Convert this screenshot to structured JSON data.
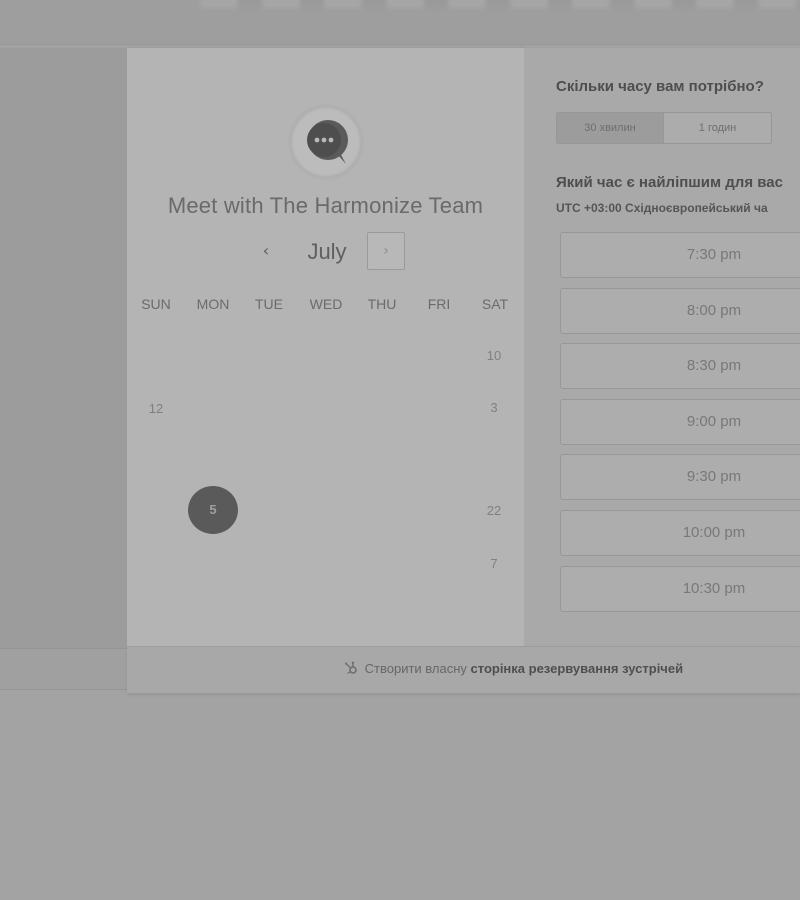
{
  "calendar": {
    "title": "Meet with The Harmonize Team",
    "month": "July",
    "prev_glyph": "‹",
    "next_glyph": "›",
    "weekdays": [
      "SUN",
      "MON",
      "TUE",
      "WED",
      "THU",
      "FRI",
      "SAT"
    ],
    "days": [
      "10",
      "12",
      "3",
      "22",
      "7"
    ],
    "selected_day": "5"
  },
  "scheduler": {
    "duration_question": "Скільки часу вам потрібно?",
    "durations": [
      "30 хвилин",
      "1 годин"
    ],
    "active_duration": "30 хвилин",
    "time_question": "Який час є найліпшим для вас",
    "timezone": "UTC +03:00 Східноєвропейський ча",
    "slots": [
      "7:30 pm",
      "8:00 pm",
      "8:30 pm",
      "9:00 pm",
      "9:30 pm",
      "10:00 pm",
      "10:30 pm"
    ]
  },
  "footer": {
    "link_prefix": "Створити власну",
    "link_bold": "сторінка резервування зустрічей"
  },
  "icons": {
    "avatar": "chat-bubble-icon",
    "footer": "hubspot-sprocket-icon"
  }
}
